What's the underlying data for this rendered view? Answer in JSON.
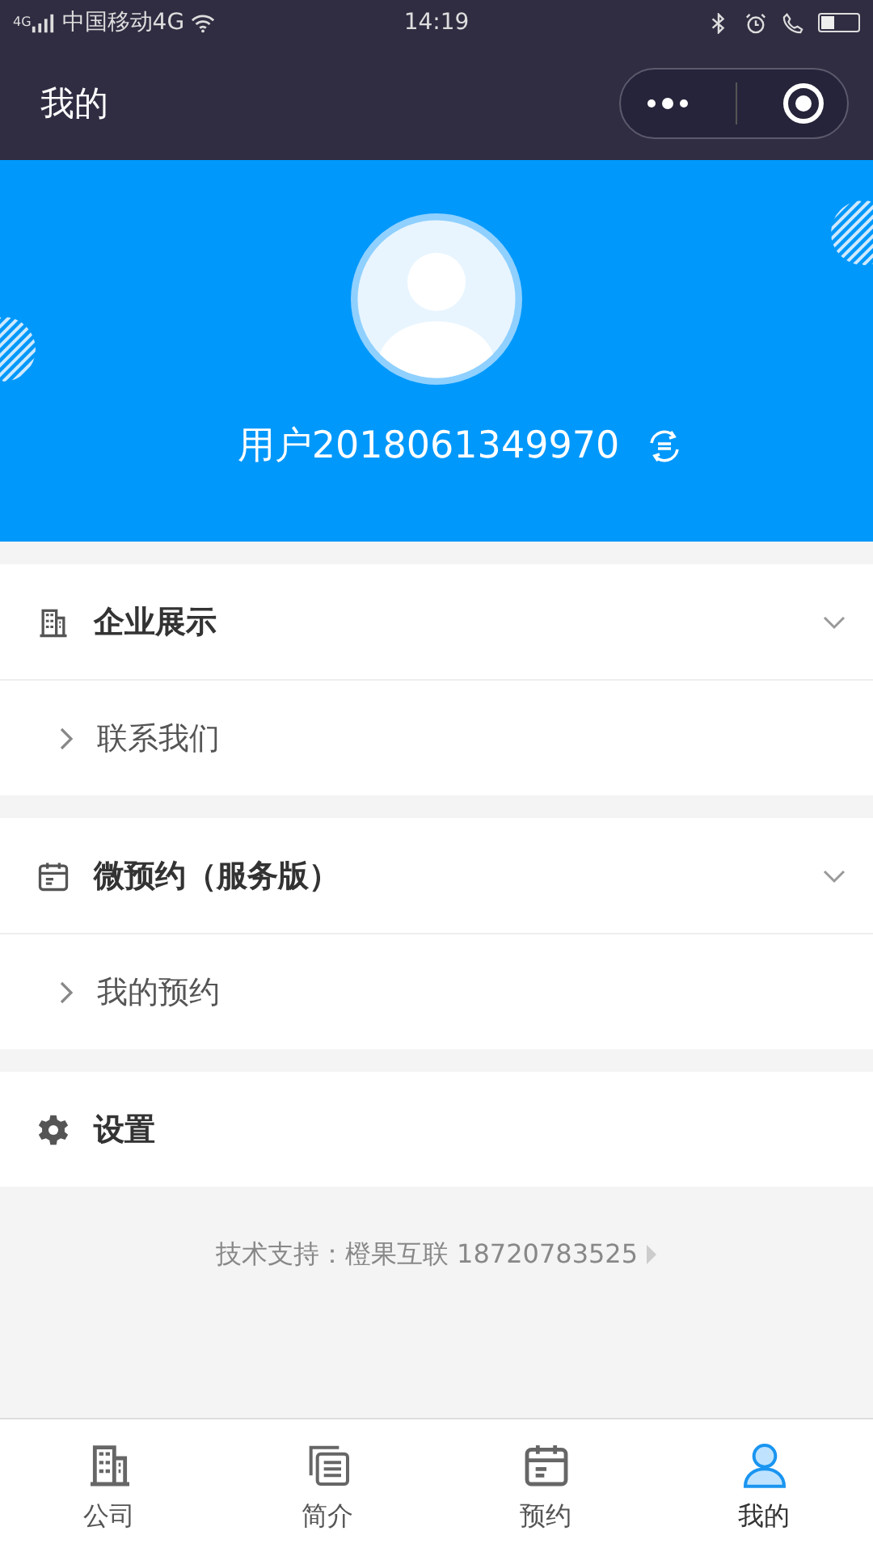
{
  "status_bar": {
    "network": "4G",
    "carrier": "中国移动4G",
    "time": "14:19"
  },
  "nav": {
    "title": "我的"
  },
  "profile": {
    "username": "用户2018061349970"
  },
  "sections": [
    {
      "kind": "group",
      "title": "企业展示",
      "expanded": true,
      "children": [
        {
          "label": "联系我们"
        }
      ]
    },
    {
      "kind": "group",
      "title": "微预约（服务版）",
      "expanded": true,
      "children": [
        {
          "label": "我的预约"
        }
      ]
    },
    {
      "kind": "single",
      "title": "设置"
    }
  ],
  "footer": {
    "text": "技术支持：橙果互联 18720783525"
  },
  "tabs": [
    {
      "label": "公司",
      "selected": false
    },
    {
      "label": "简介",
      "selected": false
    },
    {
      "label": "预约",
      "selected": false
    },
    {
      "label": "我的",
      "selected": true
    }
  ]
}
